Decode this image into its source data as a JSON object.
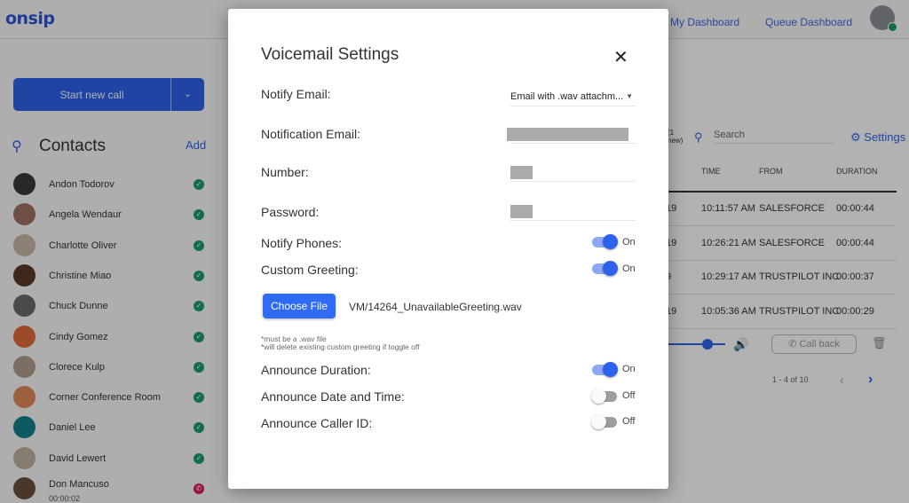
{
  "header": {
    "logo": "onsip",
    "tabs": [
      {
        "label": "My Dashboard",
        "active": true
      },
      {
        "label": "Queue Dashboard",
        "active": false
      }
    ]
  },
  "sidebar": {
    "start_call": "Start new call",
    "contacts_title": "Contacts",
    "add": "Add",
    "contacts": [
      {
        "name": "Andon Todorov",
        "status": "available"
      },
      {
        "name": "Angela Wendaur",
        "status": "available"
      },
      {
        "name": "Charlotte Oliver",
        "status": "available"
      },
      {
        "name": "Christine Miao",
        "status": "available"
      },
      {
        "name": "Chuck Dunne",
        "status": "available"
      },
      {
        "name": "Cindy Gomez",
        "status": "available"
      },
      {
        "name": "Clorece Kulp",
        "status": "available"
      },
      {
        "name": "Corner Conference Room",
        "status": "available"
      },
      {
        "name": "Daniel Lee",
        "status": "available"
      },
      {
        "name": "David Lewert",
        "status": "available"
      },
      {
        "name": "Don Mancuso",
        "status": "on-call",
        "sub": "00:00:02"
      }
    ]
  },
  "voicemail": {
    "new_count": "(1\nnew)",
    "search_placeholder": "Search",
    "settings": "Settings",
    "columns": [
      "TIME",
      "FROM",
      "DURATION"
    ],
    "rows": [
      {
        "date": "19",
        "time": "10:11:57 AM",
        "from": "SALESFORCE",
        "duration": "00:00:44"
      },
      {
        "date": "19",
        "time": "10:26:21 AM",
        "from": "SALESFORCE",
        "duration": "00:00:44"
      },
      {
        "date": "9",
        "time": "10:29:17 AM",
        "from": "TRUSTPILOT INC",
        "duration": "00:00:37"
      },
      {
        "date": "19",
        "time": "10:05:36 AM",
        "from": "TRUSTPILOT INC",
        "duration": "00:00:29"
      }
    ],
    "call_back": "Call back",
    "pagination": "1 - 4 of 10"
  },
  "modal": {
    "title": "Voicemail Settings",
    "notify_email_label": "Notify Email:",
    "notify_email_value": "Email with .wav attachm...",
    "notification_email_label": "Notification Email:",
    "number_label": "Number:",
    "password_label": "Password:",
    "notify_phones_label": "Notify Phones:",
    "notify_phones": "On",
    "custom_greeting_label": "Custom Greeting:",
    "custom_greeting": "On",
    "choose_file": "Choose File",
    "file_name": "VM/14264_UnavailableGreeting.wav",
    "note1": "*must be a .wav file",
    "note2": "*will delete existing custom greeting if toggle off",
    "announce_duration_label": "Announce Duration:",
    "announce_duration": "On",
    "announce_datetime_label": "Announce Date and Time:",
    "announce_datetime": "Off",
    "announce_callerid_label": "Announce Caller ID:",
    "announce_callerid": "Off"
  },
  "colors": {
    "accent": "#2f62ea",
    "available": "#1c9b6a",
    "on_call": "#d81b60"
  }
}
